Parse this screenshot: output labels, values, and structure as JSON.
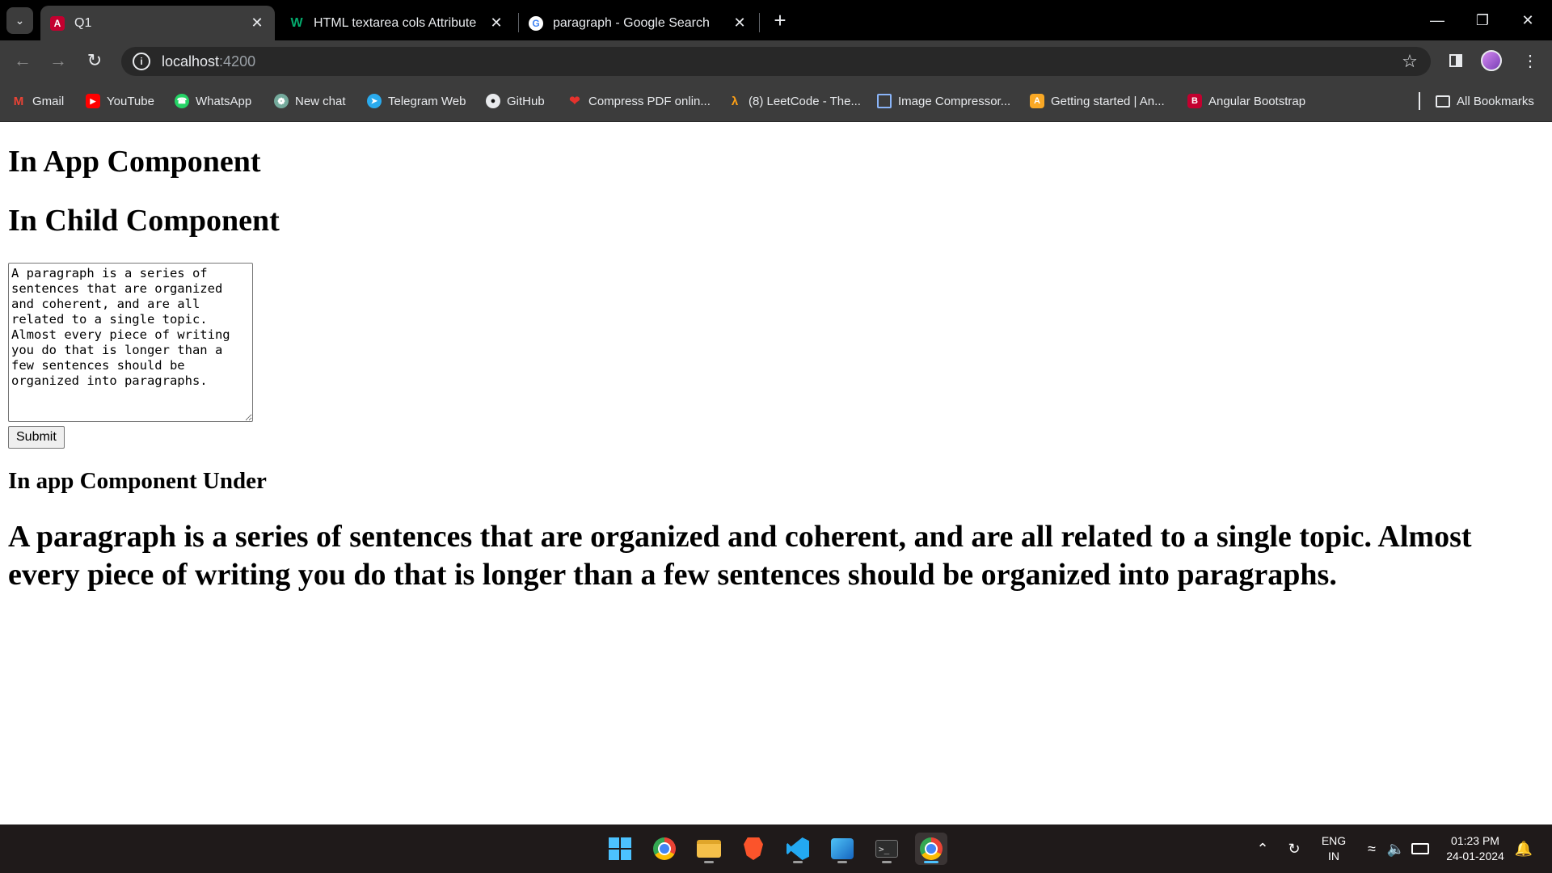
{
  "browser": {
    "tabs": [
      {
        "title": "Q1",
        "favicon": "angular-icon",
        "active": true
      },
      {
        "title": "HTML textarea cols Attribute",
        "favicon": "w3schools-icon",
        "active": false
      },
      {
        "title": "paragraph - Google Search",
        "favicon": "google-icon",
        "active": false
      }
    ],
    "url_host": "localhost",
    "url_port": ":4200",
    "bookmarks": [
      {
        "label": "Gmail",
        "icon": "gmail-icon"
      },
      {
        "label": "YouTube",
        "icon": "youtube-icon"
      },
      {
        "label": "WhatsApp",
        "icon": "whatsapp-icon"
      },
      {
        "label": "New chat",
        "icon": "chatgpt-icon"
      },
      {
        "label": "Telegram Web",
        "icon": "telegram-icon"
      },
      {
        "label": "GitHub",
        "icon": "github-icon"
      },
      {
        "label": "Compress PDF onlin...",
        "icon": "compress-pdf-icon"
      },
      {
        "label": "(8) LeetCode - The...",
        "icon": "leetcode-icon"
      },
      {
        "label": "Image Compressor...",
        "icon": "image-compressor-icon"
      },
      {
        "label": "Getting started | An...",
        "icon": "angular-shield-icon"
      },
      {
        "label": "Angular Bootstrap",
        "icon": "bootstrap-icon"
      }
    ],
    "all_bookmarks": "All Bookmarks"
  },
  "page": {
    "app_heading": "In App Component",
    "child_heading": "In Child Component",
    "textarea_value": "A paragraph is a series of sentences that are organized and coherent, and are all related to a single topic. Almost every piece of writing you do that is longer than a few sentences should be organized into paragraphs.",
    "submit_label": "Submit",
    "under_heading": "In app Component Under",
    "output_paragraph": "A paragraph is a series of sentences that are organized and coherent, and are all related to a single topic. Almost every piece of writing you do that is longer than a few sentences should be organized into paragraphs."
  },
  "taskbar": {
    "apps": [
      "windows-start-icon",
      "chrome-icon",
      "file-explorer-icon",
      "brave-icon",
      "vscode-icon",
      "photos-icon",
      "terminal-icon",
      "chrome-active-icon"
    ],
    "language_top": "ENG",
    "language_bottom": "IN",
    "time": "01:23 PM",
    "date": "24-01-2024"
  },
  "colors": {
    "tabstrip": "#000000",
    "toolbar": "#3c3c3c",
    "omnibox": "#282828",
    "taskbar": "#1f1a1a",
    "accent": "#4cc2ff"
  }
}
